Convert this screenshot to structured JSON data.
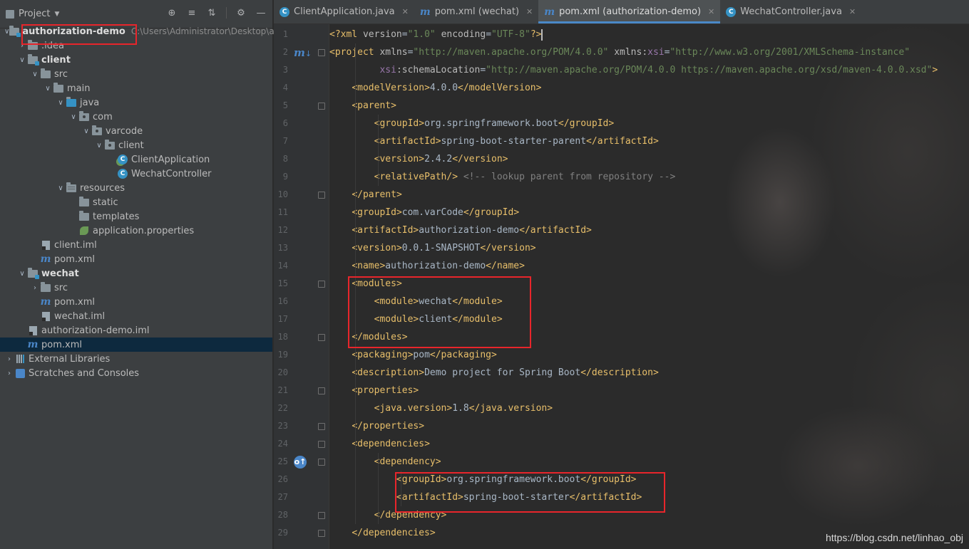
{
  "project_panel": {
    "title": "Project",
    "root": {
      "name": "authorization-demo",
      "path": "C:\\Users\\Administrator\\Desktop\\aut"
    },
    "tree": [
      {
        "label": "authorization-demo",
        "icon": "module-folder-icon"
      },
      {
        "label": ".idea",
        "icon": "folder-icon"
      },
      {
        "label": "client",
        "icon": "module-folder-icon"
      },
      {
        "label": "src",
        "icon": "folder-icon"
      },
      {
        "label": "main",
        "icon": "folder-icon"
      },
      {
        "label": "java",
        "icon": "source-folder-icon"
      },
      {
        "label": "com",
        "icon": "package-icon"
      },
      {
        "label": "varcode",
        "icon": "package-icon"
      },
      {
        "label": "client",
        "icon": "package-icon"
      },
      {
        "label": "ClientApplication",
        "icon": "spring-class-icon"
      },
      {
        "label": "WechatController",
        "icon": "class-icon"
      },
      {
        "label": "resources",
        "icon": "resources-folder-icon"
      },
      {
        "label": "static",
        "icon": "folder-icon"
      },
      {
        "label": "templates",
        "icon": "folder-icon"
      },
      {
        "label": "application.properties",
        "icon": "spring-properties-icon"
      },
      {
        "label": "client.iml",
        "icon": "iml-file-icon"
      },
      {
        "label": "pom.xml",
        "icon": "maven-icon"
      },
      {
        "label": "wechat",
        "icon": "module-folder-icon"
      },
      {
        "label": "src",
        "icon": "folder-icon"
      },
      {
        "label": "pom.xml",
        "icon": "maven-icon"
      },
      {
        "label": "wechat.iml",
        "icon": "iml-file-icon"
      },
      {
        "label": "authorization-demo.iml",
        "icon": "iml-file-icon"
      },
      {
        "label": "pom.xml",
        "icon": "maven-icon"
      },
      {
        "label": "External Libraries",
        "icon": "libraries-icon"
      },
      {
        "label": "Scratches and Consoles",
        "icon": "scratches-icon"
      }
    ]
  },
  "tabs": [
    {
      "label": "ClientApplication.java",
      "icon": "class-icon",
      "active": false
    },
    {
      "label": "pom.xml (wechat)",
      "icon": "maven-icon",
      "active": false
    },
    {
      "label": "pom.xml (authorization-demo)",
      "icon": "maven-icon",
      "active": true
    },
    {
      "label": "WechatController.java",
      "icon": "class-icon",
      "active": false
    }
  ],
  "editor": {
    "line_numbers": [
      "1",
      "2",
      "3",
      "4",
      "5",
      "6",
      "7",
      "8",
      "9",
      "10",
      "11",
      "12",
      "13",
      "14",
      "15",
      "16",
      "17",
      "18",
      "19",
      "20",
      "21",
      "22",
      "23",
      "24",
      "25",
      "26",
      "27",
      "28",
      "29"
    ],
    "lines": [
      "<?xml version=\"1.0\" encoding=\"UTF-8\"?>",
      "<project xmlns=\"http://maven.apache.org/POM/4.0.0\" xmlns:xsi=\"http://www.w3.org/2001/XMLSchema-instance\"",
      "         xsi:schemaLocation=\"http://maven.apache.org/POM/4.0.0 https://maven.apache.org/xsd/maven-4.0.0.xsd\">",
      "    <modelVersion>4.0.0</modelVersion>",
      "    <parent>",
      "        <groupId>org.springframework.boot</groupId>",
      "        <artifactId>spring-boot-starter-parent</artifactId>",
      "        <version>2.4.2</version>",
      "        <relativePath/> <!-- lookup parent from repository -->",
      "    </parent>",
      "    <groupId>com.varCode</groupId>",
      "    <artifactId>authorization-demo</artifactId>",
      "    <version>0.0.1-SNAPSHOT</version>",
      "    <name>authorization-demo</name>",
      "    <modules>",
      "        <module>wechat</module>",
      "        <module>client</module>",
      "    </modules>",
      "    <packaging>pom</packaging>",
      "    <description>Demo project for Spring Boot</description>",
      "    <properties>",
      "        <java.version>1.8</java.version>",
      "    </properties>",
      "    <dependencies>",
      "        <dependency>",
      "            <groupId>org.springframework.boot</groupId>",
      "            <artifactId>spring-boot-starter</artifactId>",
      "        </dependency>",
      "    </dependencies>"
    ]
  },
  "watermark": "https://blog.csdn.net/linhao_obj",
  "colors": {
    "highlight_box": "#e8252b",
    "tag": "#e8bf6a",
    "value": "#6a8759",
    "accent": "#4a88c7"
  }
}
